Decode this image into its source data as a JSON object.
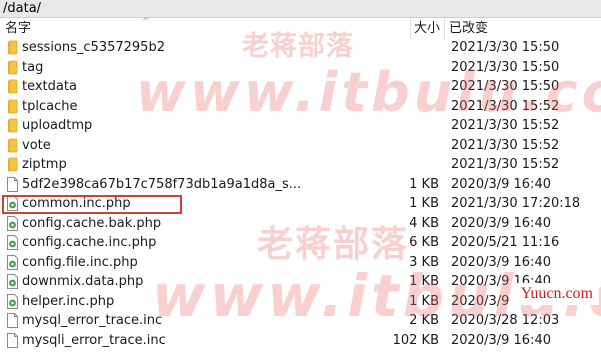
{
  "path": "/data/",
  "columns": {
    "name": "名字",
    "size": "大小",
    "date": "已改变"
  },
  "rows": [
    {
      "name": "sessions_c5357295b2",
      "size": "",
      "date": "2021/3/30 15:50",
      "icon": "folder"
    },
    {
      "name": "tag",
      "size": "",
      "date": "2021/3/30 15:50",
      "icon": "folder"
    },
    {
      "name": "textdata",
      "size": "",
      "date": "2021/3/30 15:50",
      "icon": "folder"
    },
    {
      "name": "tplcache",
      "size": "",
      "date": "2021/3/30 15:52",
      "icon": "folder"
    },
    {
      "name": "uploadtmp",
      "size": "",
      "date": "2021/3/30 15:52",
      "icon": "folder"
    },
    {
      "name": "vote",
      "size": "",
      "date": "2021/3/30 15:52",
      "icon": "folder"
    },
    {
      "name": "ziptmp",
      "size": "",
      "date": "2021/3/30 15:52",
      "icon": "folder"
    },
    {
      "name": "5df2e398ca67b17c758f73db1a9a1d8a_s...",
      "size": "1 KB",
      "date": "2020/3/9 16:40",
      "icon": "file"
    },
    {
      "name": "common.inc.php",
      "size": "1 KB",
      "date": "2021/3/30 17:20:18",
      "icon": "php"
    },
    {
      "name": "config.cache.bak.php",
      "size": "4 KB",
      "date": "2020/3/9 16:40",
      "icon": "php"
    },
    {
      "name": "config.cache.inc.php",
      "size": "6 KB",
      "date": "2020/5/21 11:16",
      "icon": "php"
    },
    {
      "name": "config.file.inc.php",
      "size": "3 KB",
      "date": "2020/3/9 16:40",
      "icon": "php"
    },
    {
      "name": "downmix.data.php",
      "size": "1 KB",
      "date": "2020/3/9 16:40",
      "icon": "php"
    },
    {
      "name": "helper.inc.php",
      "size": "1 KB",
      "date": "2020/3/9 16:40",
      "icon": "php"
    },
    {
      "name": "mysql_error_trace.inc",
      "size": "2 KB",
      "date": "2020/3/28 12:03",
      "icon": "file"
    },
    {
      "name": "mysqli_error_trace.inc",
      "size": "102 KB",
      "date": "2020/3/9 16:40",
      "icon": "file"
    }
  ],
  "watermarks": [
    "老蒋部落",
    "www.itbulu.com",
    "老蒋部落",
    "www.itbulu.com"
  ],
  "badge": "Yuucn.com",
  "colors": {
    "folder": "#f4c542",
    "highlight": "#d93a3a",
    "watermark": "#ec6c6c",
    "badge_text": "#cc1f1f"
  }
}
